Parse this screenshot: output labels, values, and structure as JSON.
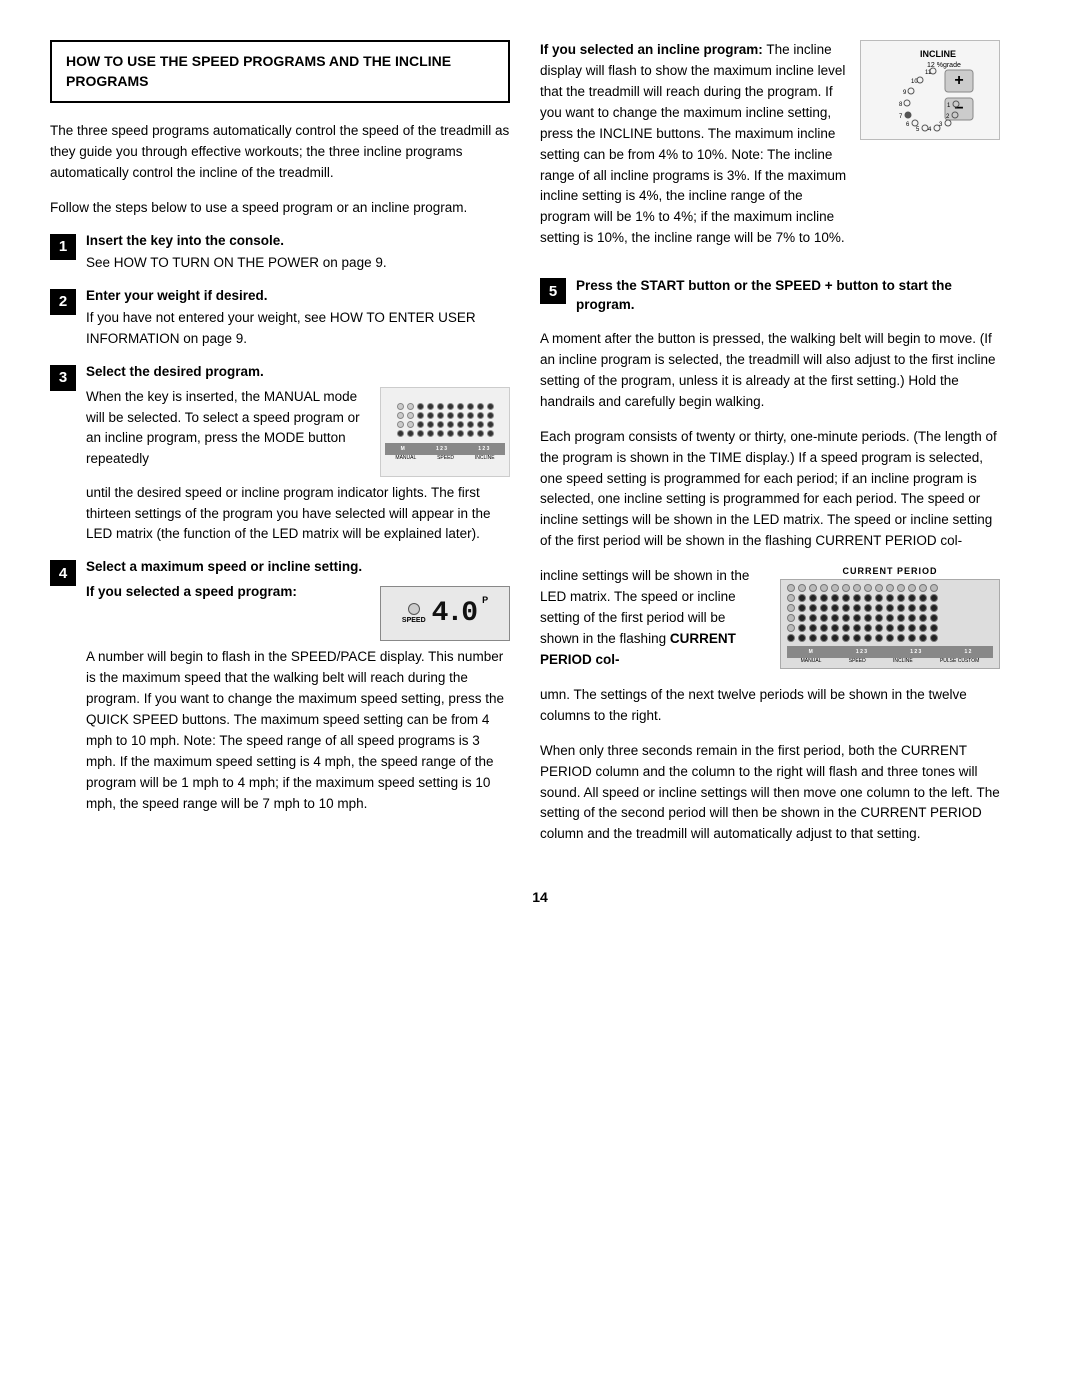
{
  "header": {
    "title": "HOW TO USE THE SPEED PROGRAMS AND THE INCLINE PROGRAMS"
  },
  "intro": {
    "para1": "The three speed programs automatically control the speed of the treadmill as they guide you through effective workouts; the three incline programs automatically control the incline of the treadmill.",
    "para2": "Follow the steps below to use a speed program or an incline program."
  },
  "steps": {
    "step1": {
      "number": "1",
      "title": "Insert the key into the console.",
      "body": "See HOW TO TURN ON THE POWER on page 9."
    },
    "step2": {
      "number": "2",
      "title": "Enter your weight if desired.",
      "body": "If you have not entered your weight, see HOW TO ENTER USER INFORMATION on page 9."
    },
    "step3": {
      "number": "3",
      "title": "Select the desired program.",
      "body1": "When the key is inserted, the MANUAL mode will be selected. To select a speed program or an incline program, press the MODE button repeatedly",
      "body2": "until the desired speed or incline program indicator lights. The first thirteen settings of the program you have selected will appear in the LED matrix (the function of the LED matrix will be explained later)."
    },
    "step4": {
      "number": "4",
      "title": "Select a maximum speed or incline setting.",
      "speedTitle": "If you selected a speed program:",
      "speedBody": "A number will begin to flash in the SPEED/PACE display. This number is the maximum speed that the walking belt will reach during the program. If you want to change the maximum speed setting, press the QUICK SPEED buttons. The maximum speed setting can be from 4 mph to 10 mph. Note: The speed range of all speed programs is 3 mph. If the maximum speed setting is 4 mph, the speed range of the program will be 1 mph to 4 mph; if the maximum speed setting is 10 mph, the speed range will be 7 mph to 10 mph.",
      "speedDisplay": "4.0"
    },
    "step5": {
      "number": "5",
      "title": "Press the START button or the SPEED + button to start the program.",
      "body1": "A moment after the button is pressed, the walking belt will begin to move. (If an incline program is selected, the treadmill will also adjust to the first incline setting of the program, unless it is already at the first setting.) Hold the handrails and carefully begin walking.",
      "body2": "Each program consists of twenty or thirty, one-minute periods. (The length of the program is shown in the TIME display.) If a speed program is selected, one speed setting is programmed for each period; if an incline program is selected, one incline setting is programmed for each period. The speed or incline settings will be shown in the LED matrix. The speed or incline setting of the first period will be shown in the flashing CURRENT PERIOD col-",
      "body2b": "umn. The settings of the next twelve periods will be shown in the twelve columns to the right.",
      "body3": "When only three seconds remain in the first period, both the CURRENT PERIOD column and the column to the right will flash and three tones will sound. All speed or incline settings will then move one column to the left. The setting of the second period will then be shown in the CURRENT PERIOD column and the treadmill will automatically adjust to that setting."
    }
  },
  "incline_section": {
    "title": "If you selected an incline program:",
    "body": "The incline display will flash to show the maximum incline level that the treadmill will reach during the program. If you want to change the maximum incline setting, press the INCLINE buttons. The maximum incline setting can be from 4% to 10%. Note: The incline range of all incline programs is 3%. If the maximum incline setting is 4%, the incline range of the program will be 1% to 4%; if the maximum incline setting is 10%, the incline range will be 7% to 10%."
  },
  "current_period_label": "CURRENT PERIOD",
  "page_number": "14"
}
